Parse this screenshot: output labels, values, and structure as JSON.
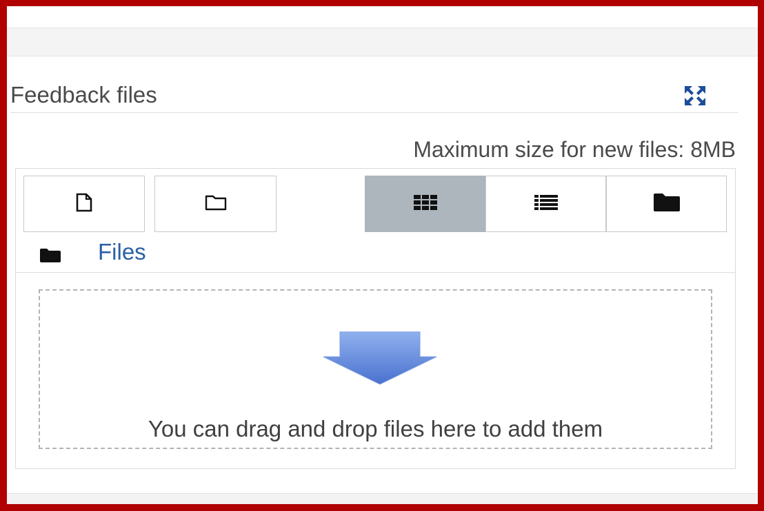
{
  "section": {
    "title": "Feedback files",
    "expand_icon": "fullscreen-arrows-icon"
  },
  "file_manager": {
    "max_size_text": "Maximum size for new files: 8MB",
    "toolbar": {
      "buttons": [
        {
          "name": "add-file-button",
          "icon": "file-icon"
        },
        {
          "name": "create-folder-button",
          "icon": "folder-outline-icon"
        }
      ],
      "view_modes": [
        {
          "name": "view-icons-button",
          "icon": "grid-icon",
          "active": true
        },
        {
          "name": "view-details-button",
          "icon": "list-icon",
          "active": false
        },
        {
          "name": "view-tree-button",
          "icon": "folder-icon",
          "active": false
        }
      ]
    },
    "path": {
      "icon": "folder-icon",
      "label": "Files"
    },
    "dropzone": {
      "icon": "down-arrow-icon",
      "text": "You can drag and drop files here to add them"
    }
  },
  "colors": {
    "frame_border": "#b00000",
    "active_toggle": "#adb6bd",
    "link": "#2b5fa5",
    "arrow": "#5b82d6",
    "icon_blue": "#1d4e9a"
  }
}
